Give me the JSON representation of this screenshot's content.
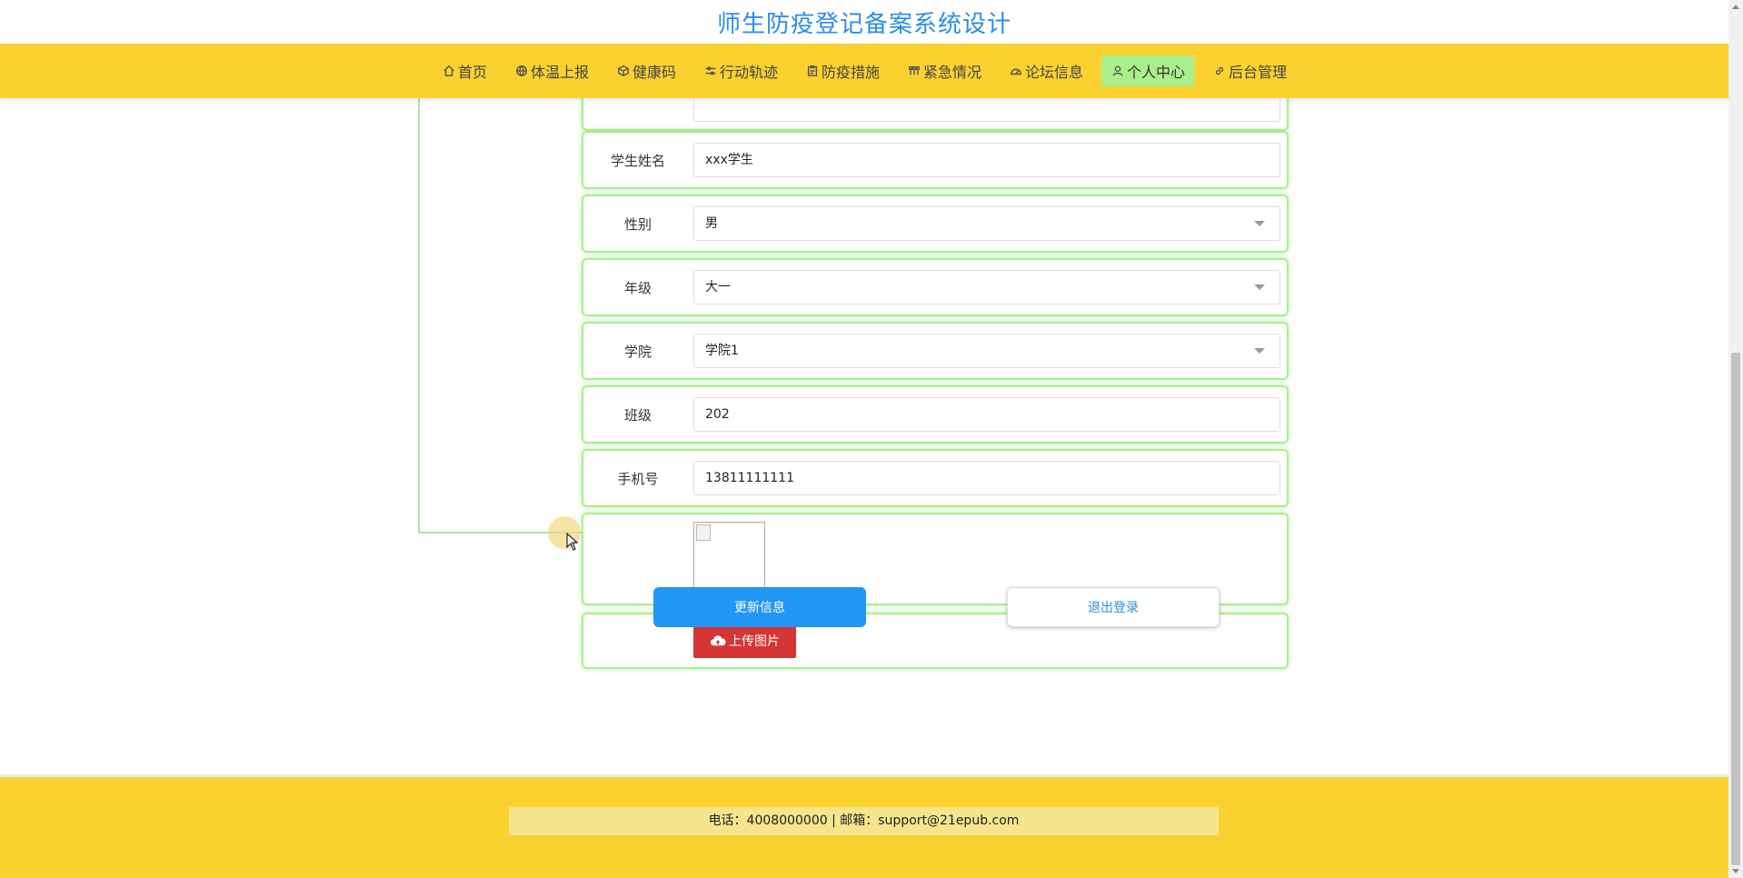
{
  "header": {
    "title": "师生防疫登记备案系统设计"
  },
  "nav": {
    "items": [
      {
        "label": "首页",
        "icon": "home-icon",
        "active": false
      },
      {
        "label": "体温上报",
        "icon": "globe-icon",
        "active": false
      },
      {
        "label": "健康码",
        "icon": "cube-icon",
        "active": false
      },
      {
        "label": "行动轨迹",
        "icon": "sliders-icon",
        "active": false
      },
      {
        "label": "防疫措施",
        "icon": "clipboard-icon",
        "active": false
      },
      {
        "label": "紧急情况",
        "icon": "grid-icon",
        "active": false
      },
      {
        "label": "论坛信息",
        "icon": "gauge-icon",
        "active": false
      },
      {
        "label": "个人中心",
        "icon": "user-icon",
        "active": true
      },
      {
        "label": "后台管理",
        "icon": "link-icon",
        "active": false
      }
    ]
  },
  "form": {
    "student_name": {
      "label": "学生姓名",
      "value": "xxx学生"
    },
    "gender": {
      "label": "性别",
      "value": "男"
    },
    "grade": {
      "label": "年级",
      "value": "大一"
    },
    "college": {
      "label": "学院",
      "value": "学院1"
    },
    "class": {
      "label": "班级",
      "value": "202"
    },
    "phone": {
      "label": "手机号",
      "value": "13811111111"
    },
    "upload_label": "上传图片"
  },
  "actions": {
    "update": "更新信息",
    "logout": "退出登录"
  },
  "footer": {
    "contact": "电话：4008000000 | 邮箱：support@21epub.com"
  },
  "colors": {
    "accent_yellow": "#fad22f",
    "active_nav": "#a9ef8b",
    "primary_blue": "#2196f3",
    "upload_red": "#d63535",
    "title_blue": "#2b8ee6"
  }
}
